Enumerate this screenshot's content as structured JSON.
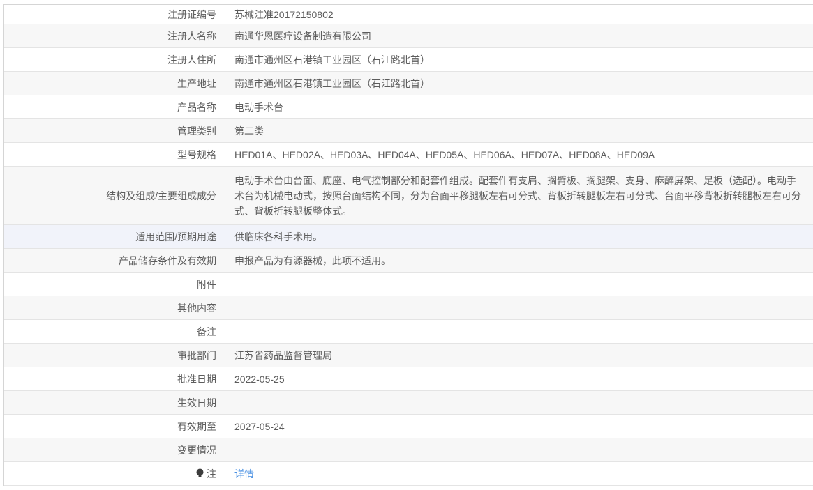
{
  "colors": {
    "link": "#4a90e2",
    "alt_row_bg": "#f7f7f7",
    "hover_row_bg": "#f1f3fa",
    "text": "#5c5c5c",
    "border": "#d5d5d5"
  },
  "table": {
    "rows": [
      {
        "label": "注册证编号",
        "value": "苏械注准20172150802"
      },
      {
        "label": "注册人名称",
        "value": "南通华恩医疗设备制造有限公司"
      },
      {
        "label": "注册人住所",
        "value": "南通市通州区石港镇工业园区（石江路北首）"
      },
      {
        "label": "生产地址",
        "value": "南通市通州区石港镇工业园区（石江路北首）"
      },
      {
        "label": "产品名称",
        "value": "电动手术台"
      },
      {
        "label": "管理类别",
        "value": "第二类"
      },
      {
        "label": "型号规格",
        "value": "HED01A、HED02A、HED03A、HED04A、HED05A、HED06A、HED07A、HED08A、HED09A"
      },
      {
        "label": "结构及组成/主要组成成分",
        "value": "电动手术台由台面、底座、电气控制部分和配套件组成。配套件有支肩、搁臂板、搁腿架、支身、麻醉屏架、足板（选配）。电动手术台为机械电动式，按照台面结构不同，分为台面平移腿板左右可分式、背板折转腿板左右可分式、台面平移背板折转腿板左右可分式、背板折转腿板整体式。"
      },
      {
        "label": "适用范围/预期用途",
        "value": "供临床各科手术用。"
      },
      {
        "label": "产品储存条件及有效期",
        "value": "申报产品为有源器械，此项不适用。"
      },
      {
        "label": "附件",
        "value": ""
      },
      {
        "label": "其他内容",
        "value": ""
      },
      {
        "label": "备注",
        "value": ""
      },
      {
        "label": "审批部门",
        "value": "江苏省药品监督管理局"
      },
      {
        "label": "批准日期",
        "value": "2022-05-25"
      },
      {
        "label": "生效日期",
        "value": ""
      },
      {
        "label": "有效期至",
        "value": "2027-05-24"
      },
      {
        "label": "变更情况",
        "value": ""
      },
      {
        "label": "注",
        "value": "",
        "icon": "lightbulb-icon",
        "link_text": "详情"
      }
    ]
  }
}
